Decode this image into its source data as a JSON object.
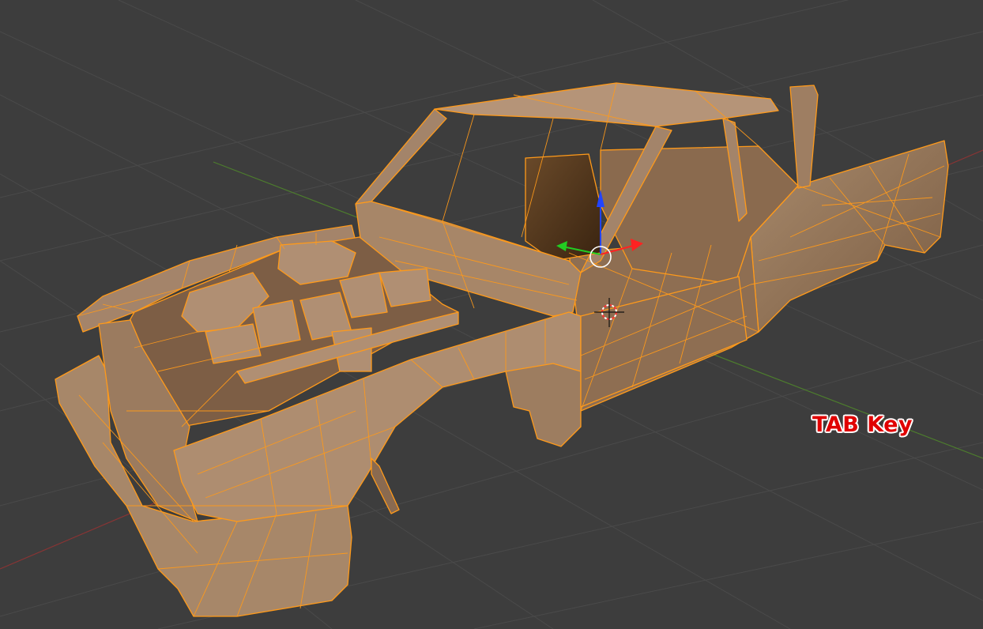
{
  "app": {
    "mode": "edit-mode",
    "viewport": "3d-viewport"
  },
  "overlay": {
    "caption": "TAB Key"
  },
  "colors": {
    "background": "#3d3d3d",
    "grid": "#4a4a4a",
    "x_axis": "#9a3a3a",
    "y_axis": "#4a8a2a",
    "mesh_face": "#9a7a5e",
    "mesh_edge": "#ff9a1a",
    "gizmo_z": "#2244ff",
    "gizmo_x": "#ff2222",
    "gizmo_y": "#22cc22",
    "caption": "#e00000"
  },
  "icons": {
    "cursor": "3d-cursor-icon",
    "gizmo": "transform-gizmo-icon"
  }
}
